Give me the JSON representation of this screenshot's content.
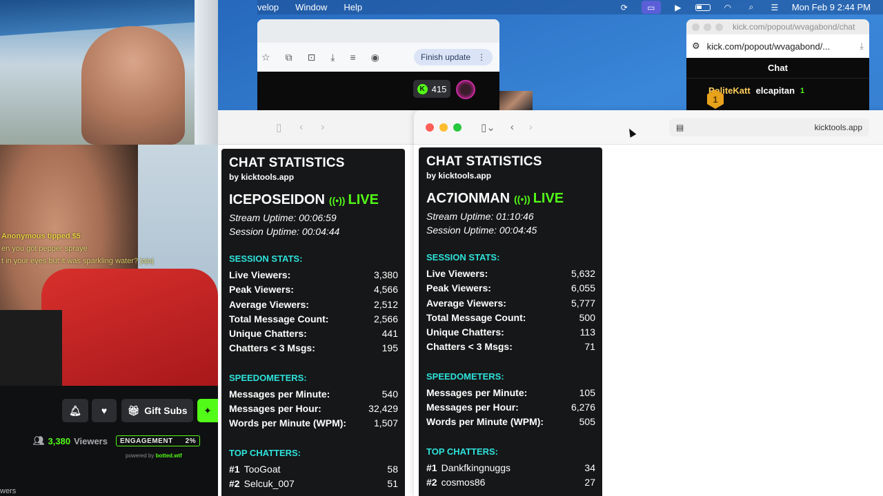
{
  "menubar": {
    "items": [
      "velop",
      "Window",
      "Help"
    ],
    "clock": "Mon Feb 9  2:44 PM"
  },
  "stream": {
    "tip_header": "Anonymous tipped $5",
    "tip_line1": "en you got pepper spraye",
    "tip_line2": "t in your eyes but it was sparkling water? jajaj",
    "controls": {
      "gift_label": "Gift Subs"
    },
    "viewers_count": "3,380",
    "viewers_label": "Viewers",
    "engagement_label": "ENGAGEMENT",
    "engagement_value": "2%",
    "powered_prefix": "powered by",
    "powered_brand": "botted.wtf",
    "bottom_cut": "wers"
  },
  "back_browser": {
    "finish_update": "Finish update",
    "kick_count": "415"
  },
  "popout": {
    "title": "kick.com/popout/wvagabond/chat",
    "url": "kick.com/popout/wvagabond/...",
    "chat_header": "Chat",
    "user1": "PoliteKatt",
    "user2": "elcapitan",
    "gift1": "1",
    "medal": "1"
  },
  "safari": {
    "url": "kicktools.app"
  },
  "panels": [
    {
      "title": "CHAT STATISTICS",
      "by": "by kicktools.app",
      "channel": "ICEPOSEIDON",
      "live": "LIVE",
      "stream_uptime": "Stream Uptime: 00:06:59",
      "session_uptime": "Session Uptime: 00:04:44",
      "session_header": "SESSION STATS:",
      "session": [
        {
          "label": "Live Viewers:",
          "value": "3,380"
        },
        {
          "label": "Peak Viewers:",
          "value": "4,566"
        },
        {
          "label": "Average Viewers:",
          "value": "2,512"
        },
        {
          "label": "Total Message Count:",
          "value": "2,566"
        },
        {
          "label": "Unique Chatters:",
          "value": "441"
        },
        {
          "label": "Chatters < 3 Msgs:",
          "value": "195"
        }
      ],
      "speed_header": "SPEEDOMETERS:",
      "speed": [
        {
          "label": "Messages per Minute:",
          "value": "540"
        },
        {
          "label": "Messages per Hour:",
          "value": "32,429"
        },
        {
          "label": "Words per Minute (WPM):",
          "value": "1,507"
        }
      ],
      "top_header": "TOP CHATTERS:",
      "top": [
        {
          "rank": "#1",
          "name": "TooGoat",
          "value": "58"
        },
        {
          "rank": "#2",
          "name": "Selcuk_007",
          "value": "51"
        }
      ]
    },
    {
      "title": "CHAT STATISTICS",
      "by": "by kicktools.app",
      "channel": "AC7IONMAN",
      "live": "LIVE",
      "stream_uptime": "Stream Uptime: 01:10:46",
      "session_uptime": "Session Uptime: 00:04:45",
      "session_header": "SESSION STATS:",
      "session": [
        {
          "label": "Live Viewers:",
          "value": "5,632"
        },
        {
          "label": "Peak Viewers:",
          "value": "6,055"
        },
        {
          "label": "Average Viewers:",
          "value": "5,777"
        },
        {
          "label": "Total Message Count:",
          "value": "500"
        },
        {
          "label": "Unique Chatters:",
          "value": "113"
        },
        {
          "label": "Chatters < 3 Msgs:",
          "value": "71"
        }
      ],
      "speed_header": "SPEEDOMETERS:",
      "speed": [
        {
          "label": "Messages per Minute:",
          "value": "105"
        },
        {
          "label": "Messages per Hour:",
          "value": "6,276"
        },
        {
          "label": "Words per Minute (WPM):",
          "value": "505"
        }
      ],
      "top_header": "TOP CHATTERS:",
      "top": [
        {
          "rank": "#1",
          "name": "Dankfkingnuggs",
          "value": "34"
        },
        {
          "rank": "#2",
          "name": "cosmos86",
          "value": "27"
        }
      ]
    }
  ],
  "colors": {
    "live_green": "#53fc18",
    "section_cyan": "#2de3dc",
    "panel_bg": "#161718"
  }
}
